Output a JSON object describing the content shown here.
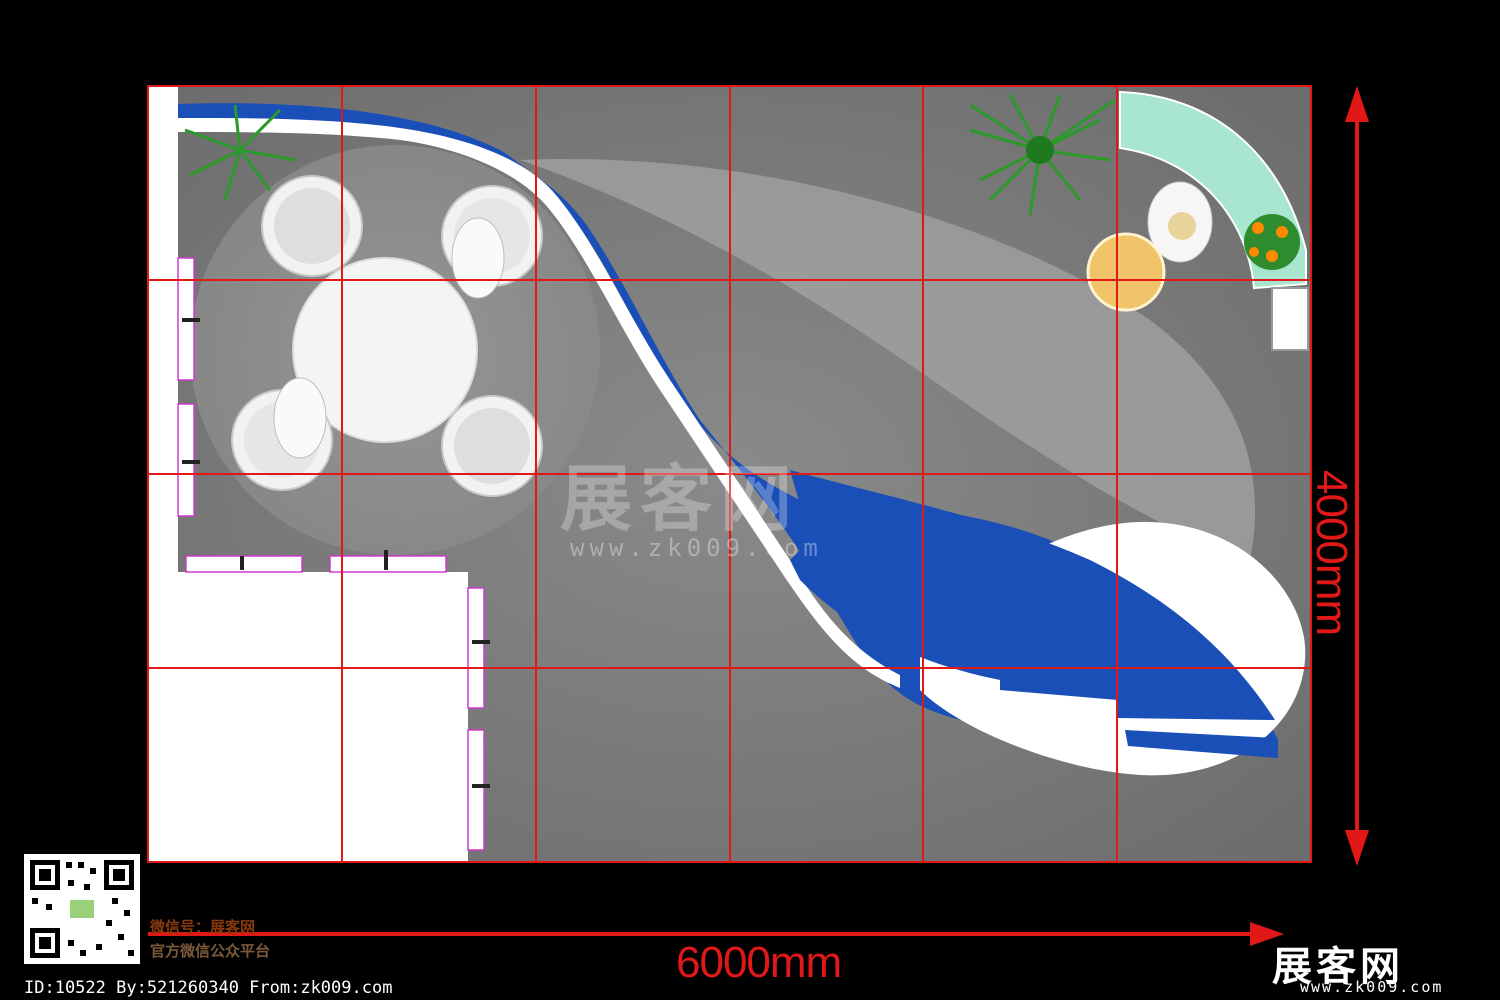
{
  "dimensions": {
    "width_label": "6000mm",
    "height_label": "4000mm"
  },
  "watermark": {
    "center_text": "展客网",
    "center_url": "www.zk009.com"
  },
  "footer": {
    "wechat_line_1": "微信号：展客网",
    "wechat_line_2": "官方微信公众平台",
    "id_line": "ID:10522 By:521260340 From:zk009.com"
  },
  "brand": {
    "logo_text": "展客网",
    "url": "www.zk009.com"
  },
  "colors": {
    "background": "#000000",
    "floor": "#7c7c7c",
    "grid_line": "#e01818",
    "accent_blue": "#1a4fb8",
    "wall_white": "#ffffff",
    "reception_counter": "#a8e6d0",
    "plant_green": "#2a9a2a",
    "small_table": "#f2c46a"
  },
  "icons": [
    "qr-code-icon",
    "plant-icon",
    "chair-icon",
    "person-icon",
    "flower-pot-icon"
  ]
}
